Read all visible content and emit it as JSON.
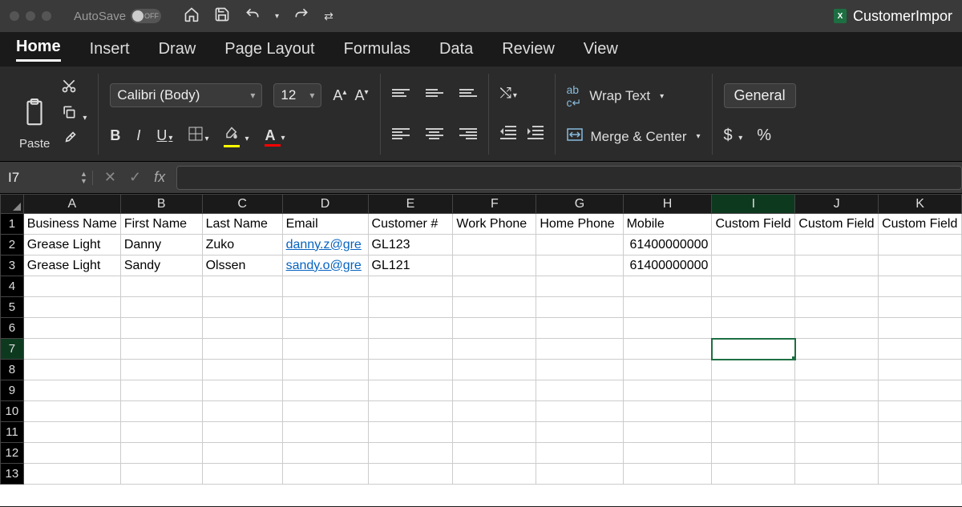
{
  "titlebar": {
    "autosave_label": "AutoSave",
    "autosave_state": "OFF",
    "filename": "CustomerImpor"
  },
  "menu": {
    "tabs": [
      "Home",
      "Insert",
      "Draw",
      "Page Layout",
      "Formulas",
      "Data",
      "Review",
      "View"
    ],
    "active": "Home"
  },
  "ribbon": {
    "paste_label": "Paste",
    "font_name": "Calibri (Body)",
    "font_size": "12",
    "wrap_label": "Wrap Text",
    "merge_label": "Merge & Center",
    "number_format": "General"
  },
  "formula_bar": {
    "name_box": "I7",
    "formula": ""
  },
  "grid": {
    "columns": [
      "A",
      "B",
      "C",
      "D",
      "E",
      "F",
      "G",
      "H",
      "I",
      "J",
      "K"
    ],
    "row_count": 13,
    "selected_cell": "I7",
    "headers": [
      "Business Name",
      "First Name",
      "Last Name",
      "Email",
      "Customer #",
      "Work Phone",
      "Home Phone",
      "Mobile",
      "Custom Field",
      "Custom Field",
      "Custom Field"
    ],
    "rows": [
      {
        "A": "Grease Light",
        "B": "Danny",
        "C": "Zuko",
        "D": "danny.z@gre",
        "E": "GL123",
        "F": "",
        "G": "",
        "H": "61400000000",
        "I": "",
        "J": "",
        "K": ""
      },
      {
        "A": "Grease Light",
        "B": "Sandy",
        "C": "Olssen",
        "D": "sandy.o@gre",
        "E": "GL121",
        "F": "",
        "G": "",
        "H": "61400000000",
        "I": "",
        "J": "",
        "K": ""
      }
    ]
  }
}
